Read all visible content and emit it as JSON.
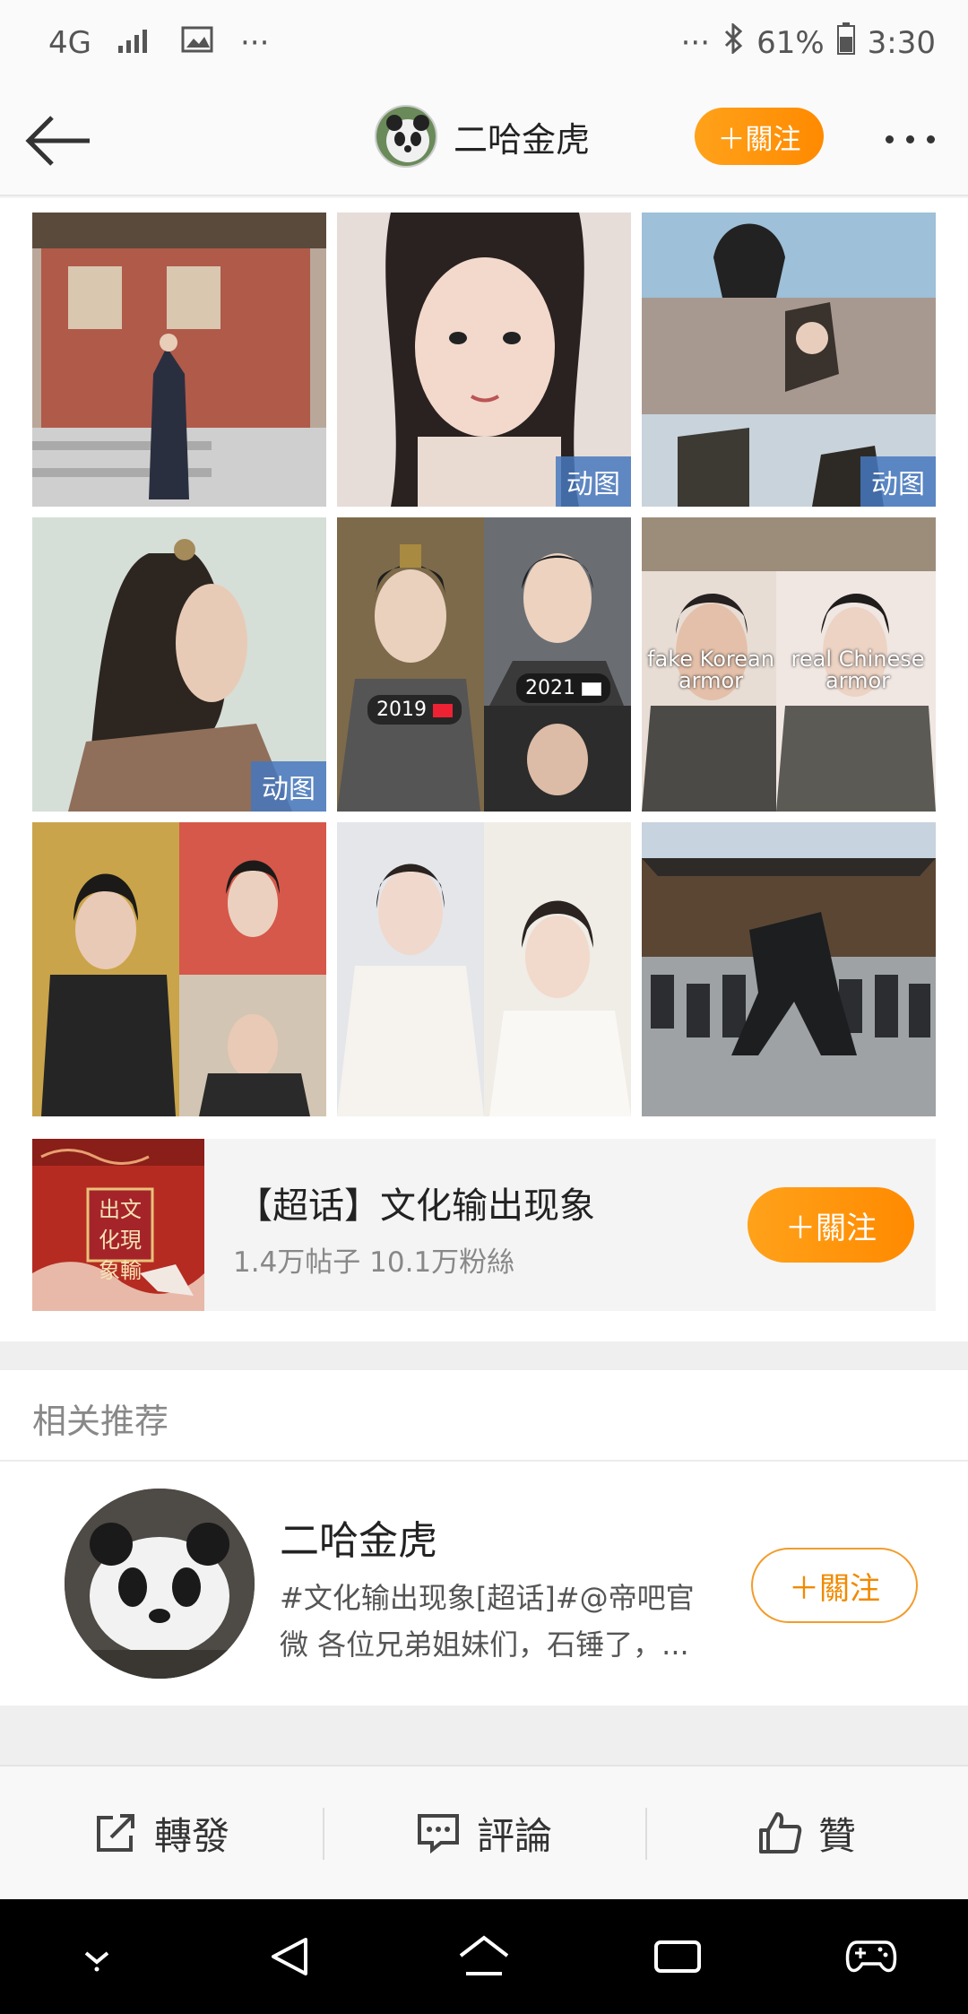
{
  "status_bar": {
    "network": "4G",
    "battery": "61%",
    "time": "3:30",
    "dots_left": "···",
    "dots_right": "···"
  },
  "nav": {
    "title": "二哈金虎",
    "follow_label": "＋關注"
  },
  "grid": {
    "gif_badge": "动图",
    "tile5_left_label": "2019",
    "tile5_right_label": "2021",
    "tile6_left_label": "fake Korean armor",
    "tile6_right_label": "real Chinese armor"
  },
  "topic": {
    "title": "【超话】文化输出现象",
    "meta": "1.4万帖子 10.1万粉絲",
    "follow_label": "＋關注",
    "image_text": "出文化現象輸"
  },
  "related": {
    "header": "相关推荐",
    "name": "二哈金虎",
    "desc_line1": "#文化输出现象[超话]#@帝吧官",
    "desc_line2": "微 各位兄弟姐妹们，石锤了，...",
    "follow_label": "＋關注"
  },
  "actions": {
    "repost": "轉發",
    "comment": "評論",
    "like": "贊"
  },
  "colors": {
    "accent": "#ff8a00",
    "badge": "#4678be"
  }
}
